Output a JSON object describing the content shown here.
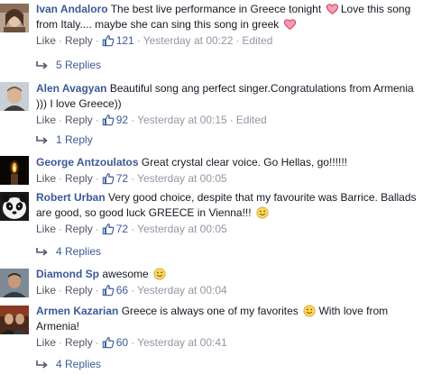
{
  "labels": {
    "like": "Like",
    "reply": "Reply",
    "sep": "·"
  },
  "comments": [
    {
      "author": "Ivan Andaloro",
      "text": "The best live performance in Greece tonight",
      "text2": "Love this song from Italy.... maybe she can sing this song in greek",
      "likes": "121",
      "timestamp": "Yesterday at 00:22",
      "edited": "Edited",
      "replies": "5 Replies",
      "avatar": "woman-avatar"
    },
    {
      "author": "Alen Avagyan",
      "text": "Beautiful song ang perfect singer.Congratulations from Armenia ))) I love Greece))",
      "likes": "92",
      "timestamp": "Yesterday at 00:15",
      "edited": "Edited",
      "replies": "1 Reply",
      "avatar": "man-avatar"
    },
    {
      "author": "George Antzoulatos",
      "text": "Great crystal clear voice. Go Hellas, go!!!!!!",
      "likes": "72",
      "timestamp": "Yesterday at 00:05",
      "avatar": "candle-avatar"
    },
    {
      "author": "Robert Urban",
      "text": "Very good choice, despite that my favourite was Barrice. Ballads are good, so good luck GREECE in Vienna!!!",
      "likes": "72",
      "timestamp": "Yesterday at 00:05",
      "replies": "4 Replies",
      "avatar": "panda-avatar"
    },
    {
      "author": "Diamond Sp",
      "text": "awesome",
      "likes": "66",
      "timestamp": "Yesterday at 00:04",
      "avatar": "man-avatar-2"
    },
    {
      "author": "Armen Kazarian",
      "text": "Greece is always one of my favorites",
      "text2": "With love from Armenia!",
      "likes": "60",
      "timestamp": "Yesterday at 00:41",
      "replies": "4 Replies",
      "avatar": "group-avatar"
    }
  ],
  "colors": {
    "link": "#3b5998",
    "meta": "#9197a3",
    "action": "#4e5665",
    "text": "#141823",
    "heart": "#e0245e"
  }
}
